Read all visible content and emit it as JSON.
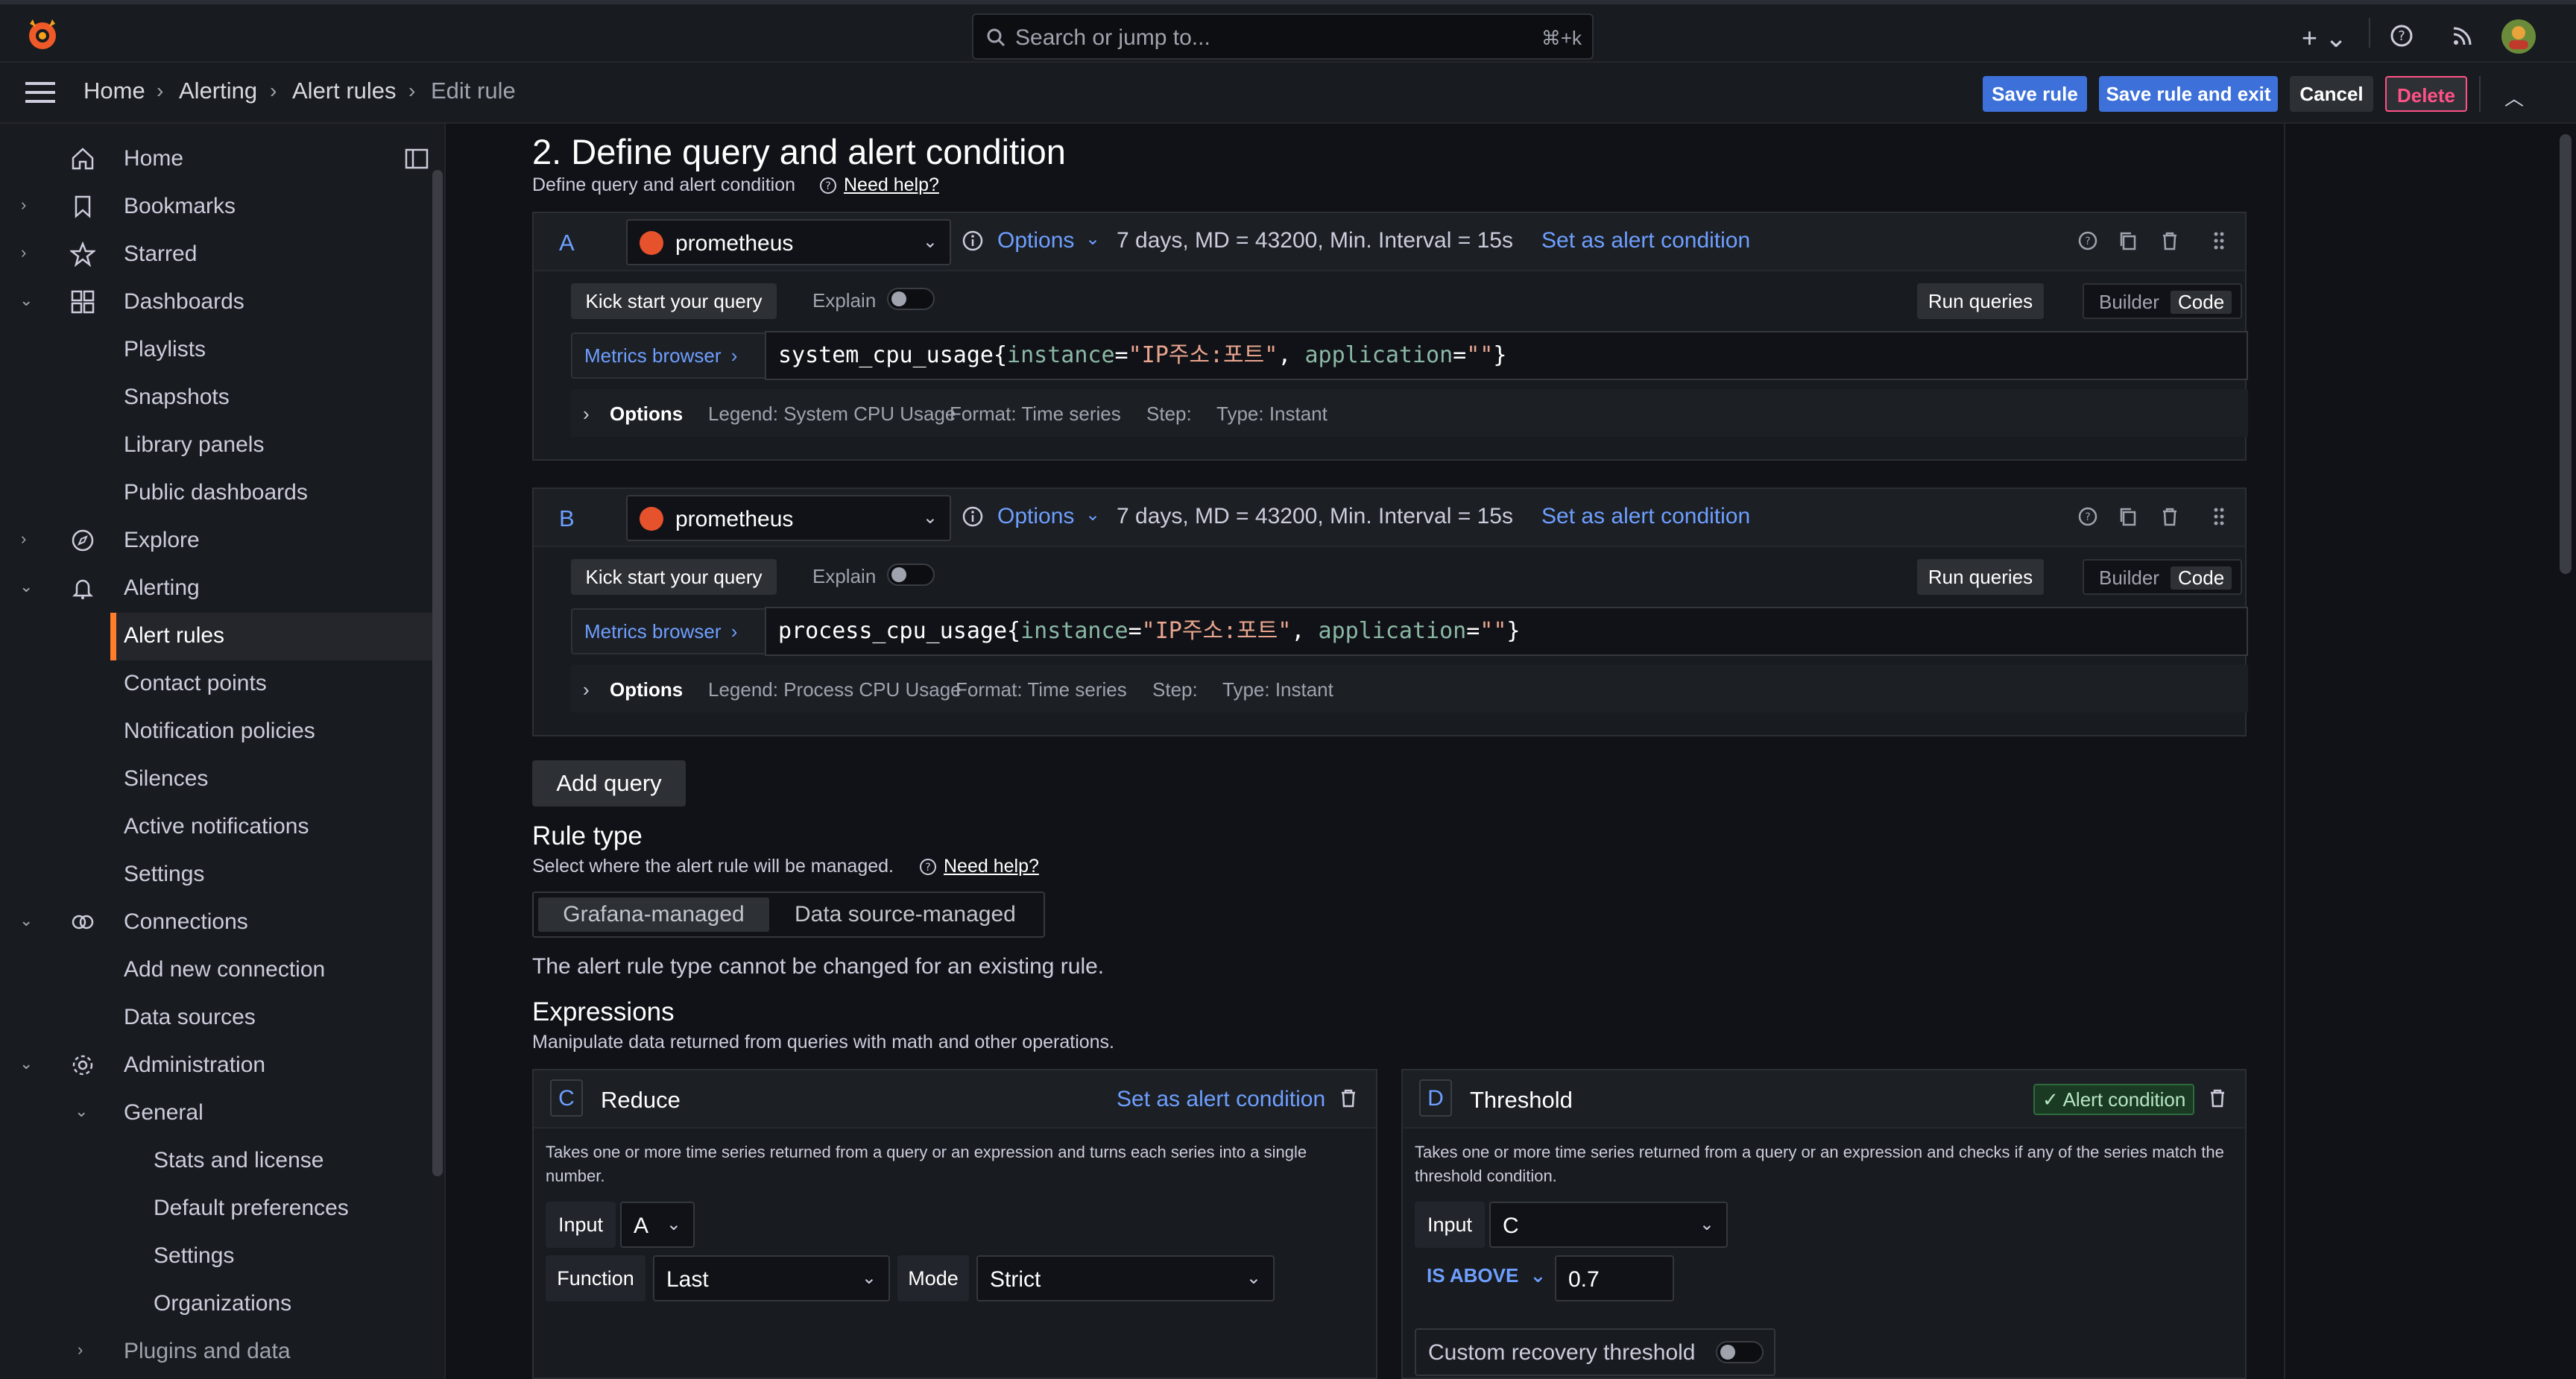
{
  "topbar": {
    "search_placeholder": "Search or jump to...",
    "search_shortcut": "⌘+k"
  },
  "breadcrumb": [
    "Home",
    "Alerting",
    "Alert rules",
    "Edit rule"
  ],
  "toolbar": {
    "save_rule": "Save rule",
    "save_rule_exit": "Save rule and exit",
    "cancel": "Cancel",
    "delete": "Delete"
  },
  "sidebar": {
    "items": [
      {
        "label": "Home"
      },
      {
        "label": "Bookmarks"
      },
      {
        "label": "Starred"
      },
      {
        "label": "Dashboards"
      },
      {
        "label": "Playlists"
      },
      {
        "label": "Snapshots"
      },
      {
        "label": "Library panels"
      },
      {
        "label": "Public dashboards"
      },
      {
        "label": "Explore"
      },
      {
        "label": "Alerting"
      },
      {
        "label": "Alert rules"
      },
      {
        "label": "Contact points"
      },
      {
        "label": "Notification policies"
      },
      {
        "label": "Silences"
      },
      {
        "label": "Active notifications"
      },
      {
        "label": "Settings"
      },
      {
        "label": "Connections"
      },
      {
        "label": "Add new connection"
      },
      {
        "label": "Data sources"
      },
      {
        "label": "Administration"
      },
      {
        "label": "General"
      },
      {
        "label": "Stats and license"
      },
      {
        "label": "Default preferences"
      },
      {
        "label": "Settings"
      },
      {
        "label": "Organizations"
      },
      {
        "label": "Plugins and data"
      }
    ]
  },
  "section": {
    "title": "2. Define query and alert condition",
    "subtitle": "Define query and alert condition",
    "need_help": "Need help?"
  },
  "queries": [
    {
      "letter": "A",
      "datasource": "prometheus",
      "options_label": "Options",
      "meta": "7 days, MD = 43200, Min. Interval = 15s",
      "set_condition": "Set as alert condition",
      "kick_start": "Kick start your query",
      "explain": "Explain",
      "run_queries": "Run queries",
      "builder": "Builder",
      "code": "Code",
      "metrics_browser": "Metrics browser",
      "expr_metric": "system_cpu_usage",
      "expr_open": "{",
      "expr_lbl1": "instance",
      "expr_eq1": "=",
      "expr_val1": "\"IP주소:포트\"",
      "expr_comma": ", ",
      "expr_lbl2": "application",
      "expr_eq2": "=",
      "expr_val2": "\"\"",
      "expr_close": "}",
      "opt_title": "Options",
      "legend": "Legend: System CPU Usage",
      "format": "Format: Time series",
      "step": "Step:",
      "type": "Type: Instant"
    },
    {
      "letter": "B",
      "datasource": "prometheus",
      "options_label": "Options",
      "meta": "7 days, MD = 43200, Min. Interval = 15s",
      "set_condition": "Set as alert condition",
      "kick_start": "Kick start your query",
      "explain": "Explain",
      "run_queries": "Run queries",
      "builder": "Builder",
      "code": "Code",
      "metrics_browser": "Metrics browser",
      "expr_metric": "process_cpu_usage",
      "expr_open": "{",
      "expr_lbl1": "instance",
      "expr_eq1": "=",
      "expr_val1": "\"IP주소:포트\"",
      "expr_comma": ", ",
      "expr_lbl2": "application",
      "expr_eq2": "=",
      "expr_val2": "\"\"",
      "expr_close": "}",
      "opt_title": "Options",
      "legend": "Legend: Process CPU Usage",
      "format": "Format: Time series",
      "step": "Step:",
      "type": "Type: Instant"
    }
  ],
  "add_query": "Add query",
  "rule_type": {
    "title": "Rule type",
    "subtitle": "Select where the alert rule will be managed.",
    "need_help": "Need help?",
    "option_grafana": "Grafana-managed",
    "option_datasource": "Data source-managed",
    "note": "The alert rule type cannot be changed for an existing rule."
  },
  "expressions": {
    "title": "Expressions",
    "subtitle": "Manipulate data returned from queries with math and other operations.",
    "reduce": {
      "letter": "C",
      "name": "Reduce",
      "set_condition": "Set as alert condition",
      "desc": "Takes one or more time series returned from a query or an expression and turns each series into a single number.",
      "input_label": "Input",
      "input_value": "A",
      "function_label": "Function",
      "function_value": "Last",
      "mode_label": "Mode",
      "mode_value": "Strict"
    },
    "threshold": {
      "letter": "D",
      "name": "Threshold",
      "badge": "Alert condition",
      "desc": "Takes one or more time series returned from a query or an expression and checks if any of the series match the threshold condition.",
      "input_label": "Input",
      "input_value": "C",
      "operator": "IS ABOVE",
      "value": "0.7",
      "recovery_label": "Custom recovery threshold"
    }
  },
  "colors": {
    "accent": "#6e9fff",
    "primary": "#3d71d9",
    "danger": "#ff5286",
    "brand": "#f05a28",
    "active_marker": "#ff7d2b"
  }
}
